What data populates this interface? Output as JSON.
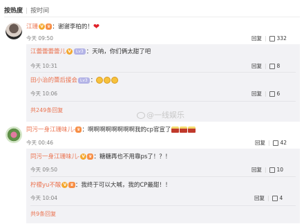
{
  "sort": {
    "hot": "按热度",
    "separator": "|",
    "time": "按时间"
  },
  "comments": [
    {
      "name": "江珊",
      "text": "：谢谢李柏的！",
      "time": "今天 09:50",
      "reply": "回复",
      "likes": "332",
      "replies": [
        {
          "name": "江蕾蕾蕾蕾儿",
          "level": "Lv3",
          "text": "：天呐，你们俩太甜了吧",
          "time": "今天 10:31",
          "reply": "回复",
          "likes": "8"
        },
        {
          "name": "田小治的蕾后援会",
          "level": "Lv3",
          "text": "：",
          "time": "今天 10:06",
          "reply": "回复",
          "likes": "6"
        }
      ],
      "more": "共249条回复"
    },
    {
      "name": "同污一身江珊味儿-",
      "text": "：啊啊啊啊啊啊啊啊我的cp官宣了",
      "time": "今天 00:46",
      "reply": "回复",
      "likes": "42",
      "replies": [
        {
          "name": "同污一身江珊味儿-",
          "text": "：糖糖再也不用靠ps了！？！",
          "time": "今天 09:50",
          "reply": "回复",
          "likes": "10"
        },
        {
          "name": "柠檬yu不酸",
          "text": "：我终于可以大喊，我的CP最甜！！",
          "time": "今天 10:04",
          "reply": "回复",
          "likes": "4"
        }
      ],
      "more": "共9条回复"
    }
  ],
  "watermark": "@一线娱乐"
}
